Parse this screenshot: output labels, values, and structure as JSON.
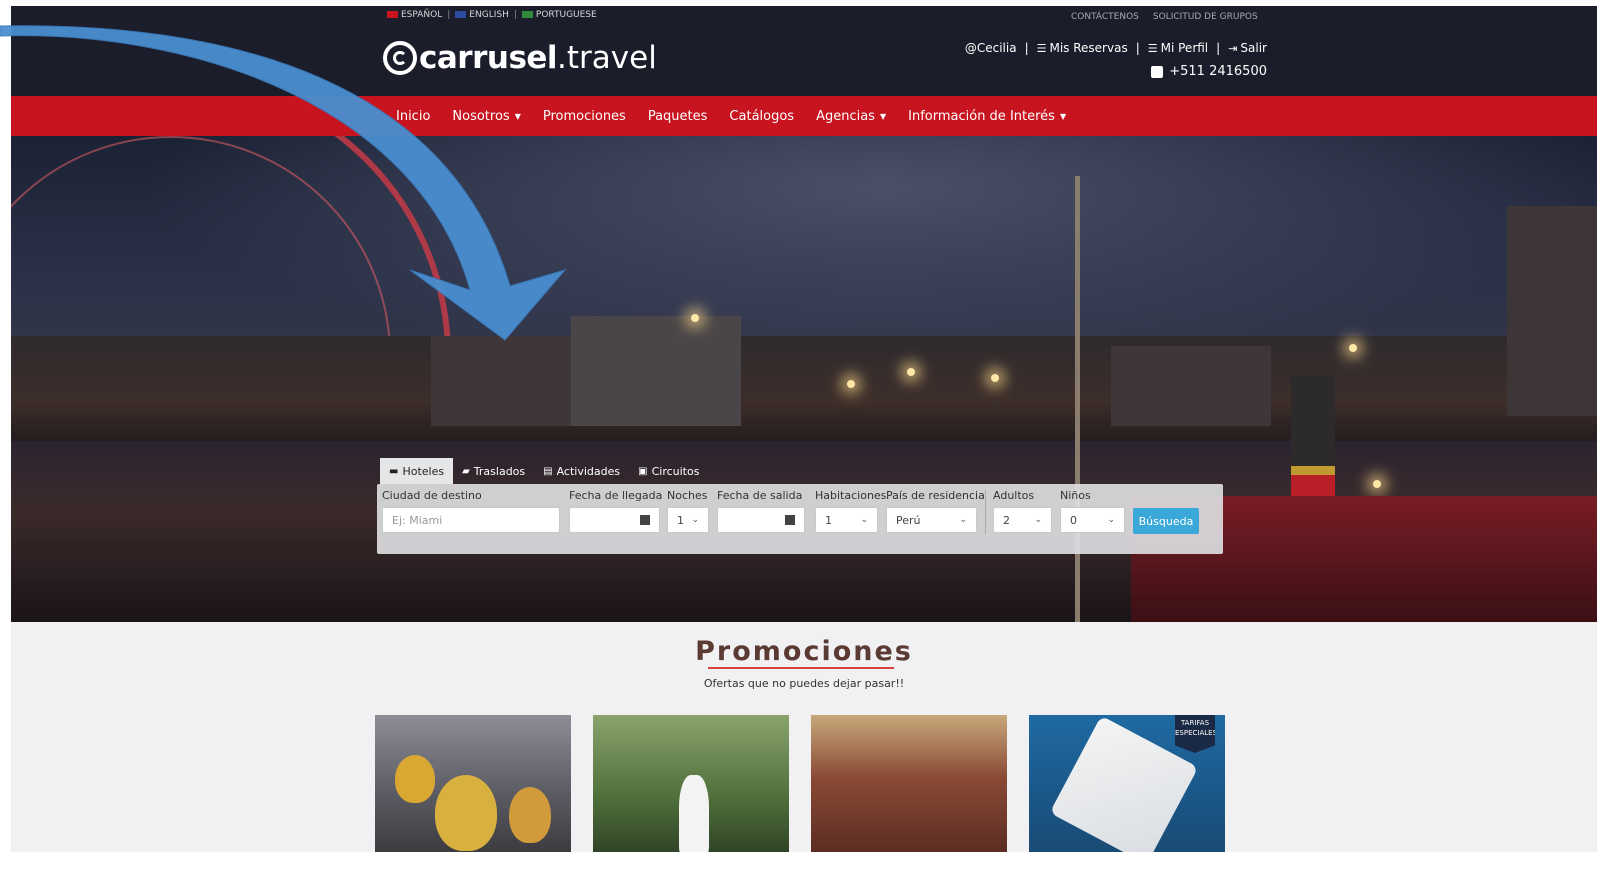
{
  "languages": [
    {
      "label": "ESPAÑOL",
      "flag_color": "#c8141f"
    },
    {
      "label": "ENGLISH",
      "flag_color": "#2b4aa0"
    },
    {
      "label": "PORTUGUESE",
      "flag_color": "#2f8a3c"
    }
  ],
  "top_links": {
    "contact": "CONTÁCTENOS",
    "groups": "SOLICITUD DE GRUPOS"
  },
  "logo": {
    "bold": "carrusel",
    "light": ".travel"
  },
  "user": {
    "handle": "@Cecilia",
    "reservations": "Mis Reservas",
    "profile": "Mi Perfil",
    "logout": "Salir",
    "phone": "+511 2416500"
  },
  "nav": {
    "items": [
      "Inicio",
      "Nosotros",
      "Promociones",
      "Paquetes",
      "Catálogos",
      "Agencias",
      "Información de Interés"
    ]
  },
  "search": {
    "tabs": [
      "Hoteles",
      "Traslados",
      "Actividades",
      "Circuitos"
    ],
    "labels": {
      "destination": "Ciudad de destino",
      "arrival": "Fecha de llegada",
      "nights": "Noches",
      "departure": "Fecha de salida",
      "rooms": "Habitaciones",
      "residence": "País de residencia",
      "adults": "Adultos",
      "children": "Niños"
    },
    "values": {
      "destination_placeholder": "Ej: Miami",
      "nights": "1",
      "rooms": "1",
      "residence": "Perú",
      "adults": "2",
      "children": "0"
    },
    "button": "Búsqueda"
  },
  "promos": {
    "title": "Promociones",
    "subtitle": "Ofertas que no puedes dejar pasar!!",
    "card4_badge": "TARIFAS ESPECIALES"
  },
  "colors": {
    "brand_red": "#c8141f",
    "header_dark": "#1b1d2a",
    "search_button": "#3aa8d8",
    "annotation_arrow": "#4a8fd0"
  }
}
